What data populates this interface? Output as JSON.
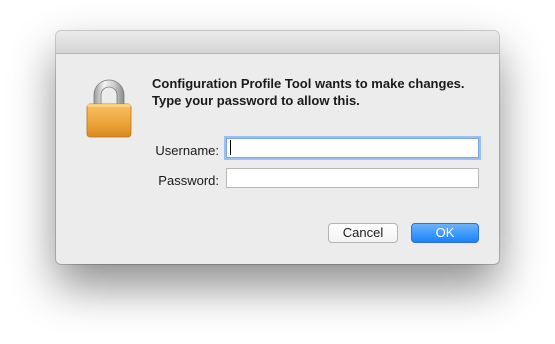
{
  "dialog": {
    "message": "Configuration Profile Tool wants to make changes. Type your password to allow this.",
    "icon": "lock-icon",
    "username": {
      "label": "Username:",
      "value": ""
    },
    "password": {
      "label": "Password:",
      "value": ""
    },
    "buttons": {
      "cancel_label": "Cancel",
      "ok_label": "OK"
    }
  },
  "colors": {
    "accent": "#1a82fb",
    "focus_ring": "#9dc0f0",
    "lock_body": "#f0a840"
  }
}
